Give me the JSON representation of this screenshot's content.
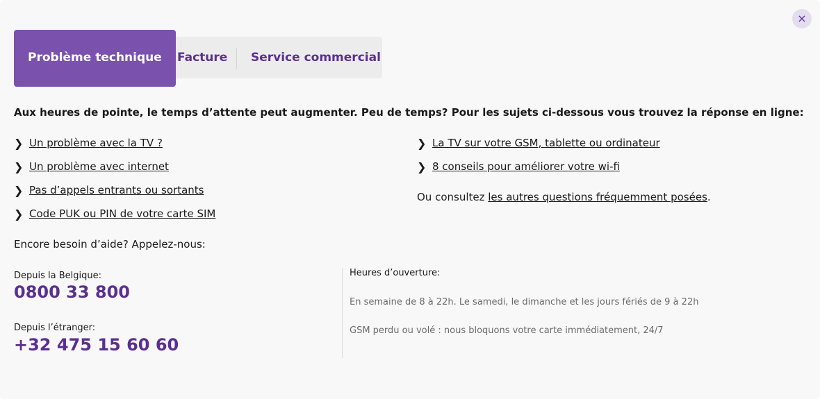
{
  "close": {
    "icon": "close-icon",
    "glyph": "×"
  },
  "tabs": [
    {
      "label": "Problème technique",
      "active": true
    },
    {
      "label": "Facture",
      "active": false
    },
    {
      "label": "Service commercial",
      "active": false
    }
  ],
  "intro": "Aux heures de pointe, le temps d’attente peut augmenter. Peu de temps? Pour les sujets ci-dessous vous trouvez la réponse en ligne:",
  "links_left": [
    "Un problème avec la TV ?",
    "Un problème avec internet",
    "Pas d’appels entrants ou sortants",
    "Code PUK ou PIN de votre carte SIM"
  ],
  "links_right": [
    "La TV sur votre GSM, tablette ou ordinateur",
    "8 conseils pour améliorer votre wi-fi"
  ],
  "faq": {
    "prefix": "Ou consultez ",
    "link": "les autres questions fréquemment posées",
    "suffix": "."
  },
  "help_heading": "Encore besoin d’aide? Appelez-nous:",
  "phones": {
    "belgium_label": "Depuis la Belgique:",
    "belgium_number": "0800 33 800",
    "abroad_label": "Depuis l’étranger:",
    "abroad_number": "+32 475 15 60 60"
  },
  "hours": {
    "title": "Heures d’ouverture:",
    "weekdays": "En semaine de 8 à 22h. Le samedi, le dimanche et les jours fériés de 9 à 22h",
    "lost_phone": "GSM perdu ou volé : nous bloquons votre carte immédiatement, 24/7"
  },
  "colors": {
    "accent": "#5b2f91",
    "active_tab": "#7a52ad",
    "tab_strip": "#ececec",
    "background": "#f8f8f8"
  }
}
